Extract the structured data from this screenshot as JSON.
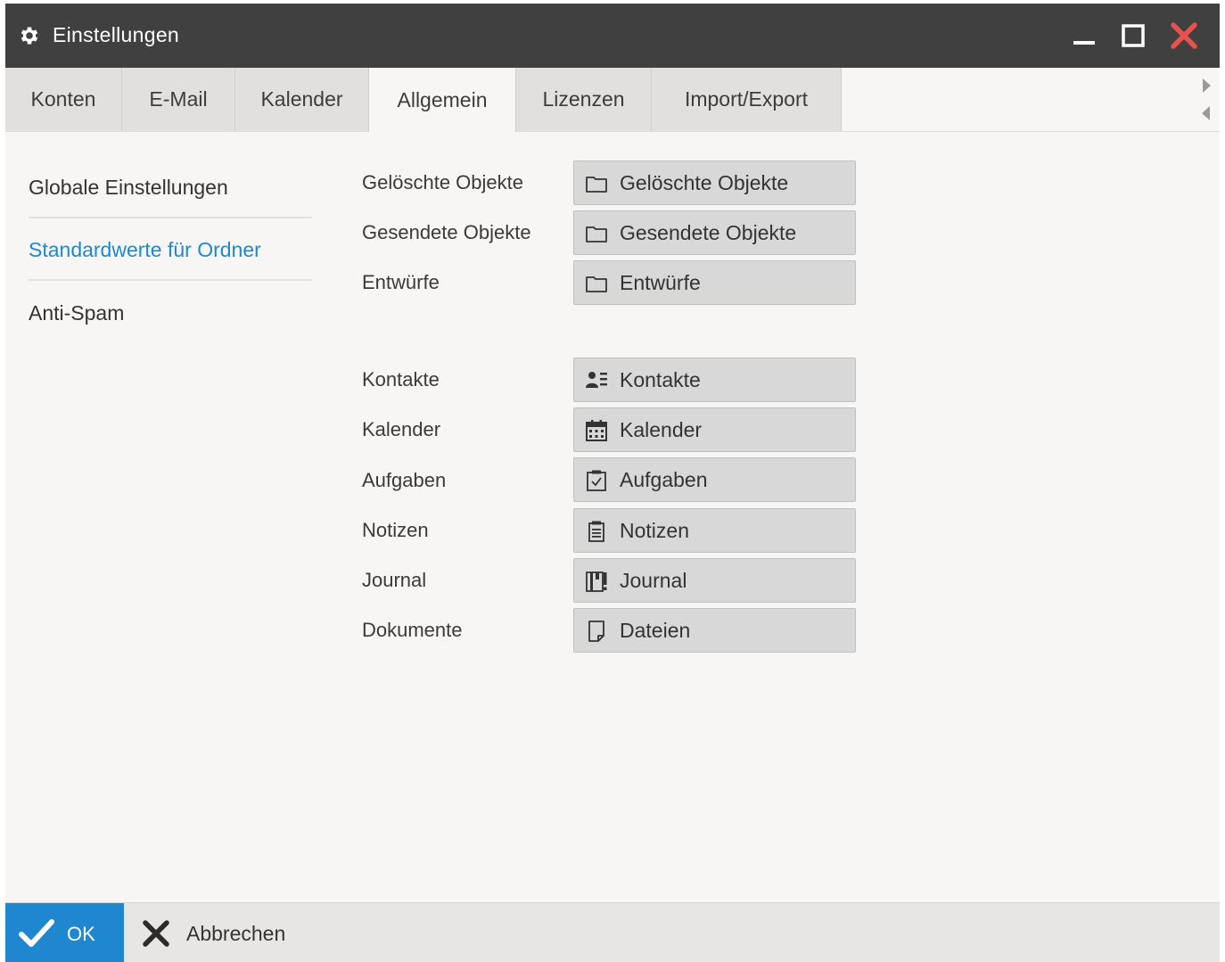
{
  "window": {
    "title": "Einstellungen",
    "icon": "gear-icon",
    "colors": {
      "titlebar": "#404040",
      "close": "#e8514d",
      "accent": "#1e87d0",
      "link": "#1b8ad3"
    }
  },
  "tabs": [
    {
      "label": "Konten"
    },
    {
      "label": "E-Mail"
    },
    {
      "label": "Kalender"
    },
    {
      "label": "Allgemein",
      "active": true
    },
    {
      "label": "Lizenzen"
    },
    {
      "label": "Import/Export"
    }
  ],
  "sidebar": {
    "items": [
      {
        "label": "Globale Einstellungen"
      },
      {
        "label": "Standardwerte für Ordner",
        "active": true
      },
      {
        "label": "Anti-Spam"
      }
    ]
  },
  "folders": [
    {
      "label": "Gelöschte Objekte",
      "value": "Gelöschte Objekte",
      "icon": "folder-icon"
    },
    {
      "label": "Gesendete Objekte",
      "value": "Gesendete Objekte",
      "icon": "folder-icon"
    },
    {
      "label": "Entwürfe",
      "value": "Entwürfe",
      "icon": "folder-icon"
    },
    {
      "label": "Kontakte",
      "value": "Kontakte",
      "icon": "contacts-icon"
    },
    {
      "label": "Kalender",
      "value": "Kalender",
      "icon": "calendar-icon"
    },
    {
      "label": "Aufgaben",
      "value": "Aufgaben",
      "icon": "tasks-icon"
    },
    {
      "label": "Notizen",
      "value": "Notizen",
      "icon": "notes-icon"
    },
    {
      "label": "Journal",
      "value": "Journal",
      "icon": "journal-icon"
    },
    {
      "label": "Dokumente",
      "value": "Dateien",
      "icon": "file-icon"
    }
  ],
  "footer": {
    "ok_label": "OK",
    "cancel_label": "Abbrechen"
  }
}
